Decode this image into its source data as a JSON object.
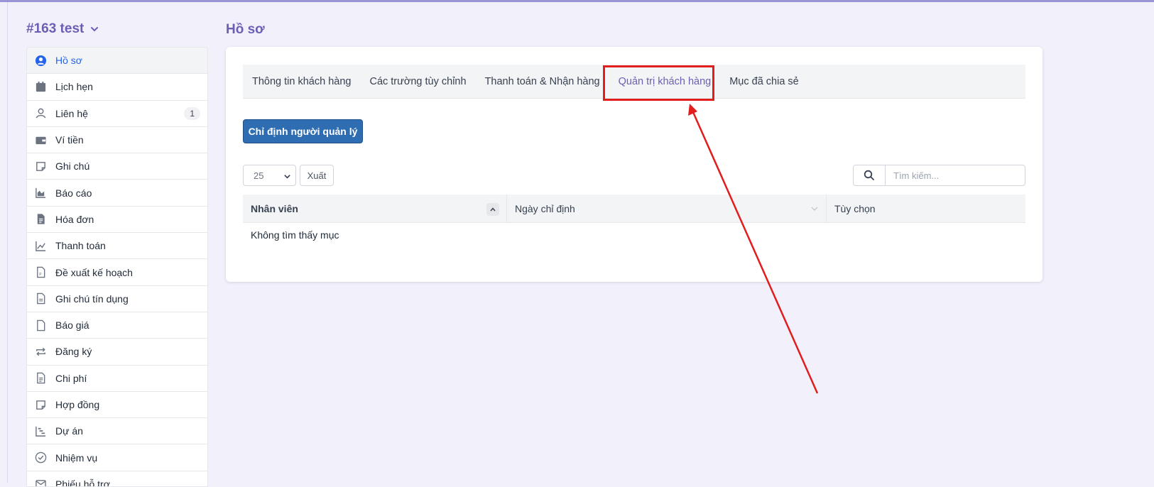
{
  "client": {
    "title": "#163 test"
  },
  "sidebar": {
    "items": [
      {
        "label": "Hồ sơ",
        "icon": "user-circle-icon",
        "active": true
      },
      {
        "label": "Lịch hẹn",
        "icon": "calendar-icon"
      },
      {
        "label": "Liên hệ",
        "icon": "user-icon",
        "badge": "1"
      },
      {
        "label": "Ví tiền",
        "icon": "wallet-icon"
      },
      {
        "label": "Ghi chú",
        "icon": "sticky-note-icon"
      },
      {
        "label": "Báo cáo",
        "icon": "area-chart-icon"
      },
      {
        "label": "Hóa đơn",
        "icon": "invoice-file-icon"
      },
      {
        "label": "Thanh toán",
        "icon": "line-chart-icon"
      },
      {
        "label": "Đề xuất kế hoạch",
        "icon": "proposal-file-icon"
      },
      {
        "label": "Ghi chú tín dụng",
        "icon": "credit-note-file-icon"
      },
      {
        "label": "Báo giá",
        "icon": "blank-file-icon"
      },
      {
        "label": "Đăng ký",
        "icon": "repeat-icon"
      },
      {
        "label": "Chi phí",
        "icon": "expense-file-icon"
      },
      {
        "label": "Hợp đồng",
        "icon": "contract-note-icon"
      },
      {
        "label": "Dự án",
        "icon": "gantt-chart-icon"
      },
      {
        "label": "Nhiệm vụ",
        "icon": "check-circle-icon"
      },
      {
        "label": "Phiếu hỗ trợ",
        "icon": "ticket-icon"
      }
    ]
  },
  "page": {
    "title": "Hồ sơ"
  },
  "tabs": [
    {
      "label": "Thông tin khách hàng"
    },
    {
      "label": "Các trường tùy chỉnh"
    },
    {
      "label": "Thanh toán & Nhận hàng"
    },
    {
      "label": "Quản trị khách hàng",
      "active": true
    },
    {
      "label": "Mục đã chia sẻ"
    }
  ],
  "assign_button": {
    "label": "Chỉ định người quản lý"
  },
  "table_controls": {
    "per_page": "25",
    "export_label": "Xuất",
    "search_placeholder": "Tìm kiếm..."
  },
  "table": {
    "columns": [
      "Nhân viên",
      "Ngày chỉ định",
      "Tùy chọn"
    ],
    "empty_text": "Không tìm thấy mục"
  },
  "annotation": {
    "highlight_color": "#e11d1d"
  },
  "colors": {
    "accent": "#6b5fb5",
    "primary_button": "#2f6db3",
    "active_link": "#2563eb"
  }
}
